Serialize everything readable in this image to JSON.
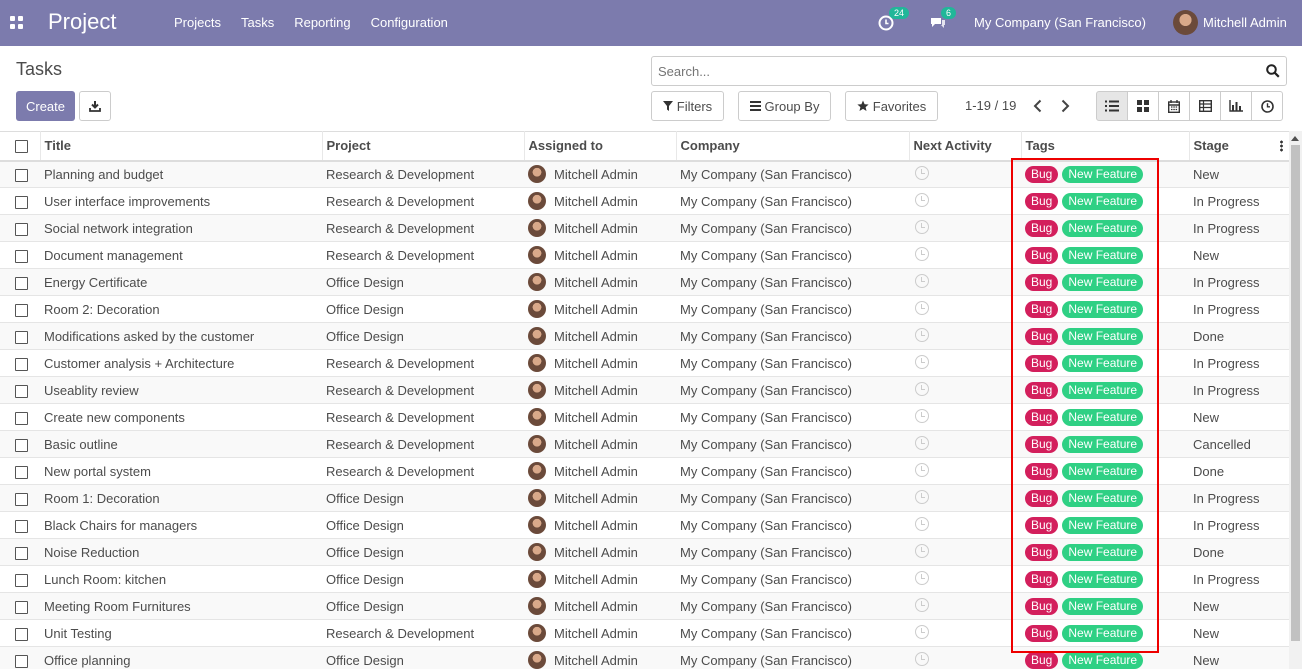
{
  "navbar": {
    "app_name": "Project",
    "menu": [
      "Projects",
      "Tasks",
      "Reporting",
      "Configuration"
    ],
    "activity_count": "24",
    "message_count": "6",
    "company": "My Company (San Francisco)",
    "user": "Mitchell Admin",
    "bg_color": "#7c7bad"
  },
  "control_panel": {
    "breadcrumb": "Tasks",
    "create_label": "Create",
    "search_placeholder": "Search...",
    "filters_label": "Filters",
    "group_by_label": "Group By",
    "favorites_label": "Favorites",
    "pager": "1-19 / 19",
    "views": [
      "list-icon",
      "kanban-icon",
      "calendar-icon",
      "pivot-icon",
      "graph-icon",
      "activity-icon"
    ]
  },
  "table": {
    "columns": [
      "Title",
      "Project",
      "Assigned to",
      "Company",
      "Next Activity",
      "Tags",
      "Stage"
    ],
    "tags": {
      "bug": "Bug",
      "feature": "New Feature",
      "bug_color": "#d31f5c",
      "feature_color": "#2fd084"
    },
    "rows": [
      {
        "title": "Planning and budget",
        "project": "Research & Development",
        "assigned": "Mitchell Admin",
        "company": "My Company (San Francisco)",
        "stage": "New"
      },
      {
        "title": "User interface improvements",
        "project": "Research & Development",
        "assigned": "Mitchell Admin",
        "company": "My Company (San Francisco)",
        "stage": "In Progress"
      },
      {
        "title": "Social network integration",
        "project": "Research & Development",
        "assigned": "Mitchell Admin",
        "company": "My Company (San Francisco)",
        "stage": "In Progress"
      },
      {
        "title": "Document management",
        "project": "Research & Development",
        "assigned": "Mitchell Admin",
        "company": "My Company (San Francisco)",
        "stage": "New"
      },
      {
        "title": "Energy Certificate",
        "project": "Office Design",
        "assigned": "Mitchell Admin",
        "company": "My Company (San Francisco)",
        "stage": "In Progress"
      },
      {
        "title": "Room 2: Decoration",
        "project": "Office Design",
        "assigned": "Mitchell Admin",
        "company": "My Company (San Francisco)",
        "stage": "In Progress"
      },
      {
        "title": "Modifications asked by the customer",
        "project": "Office Design",
        "assigned": "Mitchell Admin",
        "company": "My Company (San Francisco)",
        "stage": "Done"
      },
      {
        "title": "Customer analysis + Architecture",
        "project": "Research & Development",
        "assigned": "Mitchell Admin",
        "company": "My Company (San Francisco)",
        "stage": "In Progress"
      },
      {
        "title": "Useablity review",
        "project": "Research & Development",
        "assigned": "Mitchell Admin",
        "company": "My Company (San Francisco)",
        "stage": "In Progress"
      },
      {
        "title": "Create new components",
        "project": "Research & Development",
        "assigned": "Mitchell Admin",
        "company": "My Company (San Francisco)",
        "stage": "New"
      },
      {
        "title": "Basic outline",
        "project": "Research & Development",
        "assigned": "Mitchell Admin",
        "company": "My Company (San Francisco)",
        "stage": "Cancelled"
      },
      {
        "title": "New portal system",
        "project": "Research & Development",
        "assigned": "Mitchell Admin",
        "company": "My Company (San Francisco)",
        "stage": "Done"
      },
      {
        "title": "Room 1: Decoration",
        "project": "Office Design",
        "assigned": "Mitchell Admin",
        "company": "My Company (San Francisco)",
        "stage": "In Progress"
      },
      {
        "title": "Black Chairs for managers",
        "project": "Office Design",
        "assigned": "Mitchell Admin",
        "company": "My Company (San Francisco)",
        "stage": "In Progress"
      },
      {
        "title": "Noise Reduction",
        "project": "Office Design",
        "assigned": "Mitchell Admin",
        "company": "My Company (San Francisco)",
        "stage": "Done"
      },
      {
        "title": "Lunch Room: kitchen",
        "project": "Office Design",
        "assigned": "Mitchell Admin",
        "company": "My Company (San Francisco)",
        "stage": "In Progress"
      },
      {
        "title": "Meeting Room Furnitures",
        "project": "Office Design",
        "assigned": "Mitchell Admin",
        "company": "My Company (San Francisco)",
        "stage": "New"
      },
      {
        "title": "Unit Testing",
        "project": "Research & Development",
        "assigned": "Mitchell Admin",
        "company": "My Company (San Francisco)",
        "stage": "New"
      },
      {
        "title": "Office planning",
        "project": "Office Design",
        "assigned": "Mitchell Admin",
        "company": "My Company (San Francisco)",
        "stage": "New"
      }
    ]
  }
}
